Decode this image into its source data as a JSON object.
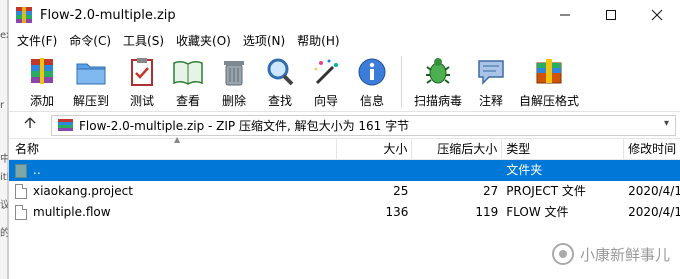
{
  "window": {
    "title": "Flow-2.0-multiple.zip"
  },
  "menu": [
    "文件(F)",
    "命令(C)",
    "工具(S)",
    "收藏夹(O)",
    "选项(N)",
    "帮助(H)"
  ],
  "toolbar": [
    {
      "label": "添加",
      "icon": "add-archive-icon"
    },
    {
      "label": "解压到",
      "icon": "extract-folder-icon"
    },
    {
      "label": "测试",
      "icon": "test-clipboard-icon"
    },
    {
      "label": "查看",
      "icon": "view-book-icon"
    },
    {
      "label": "删除",
      "icon": "trash-icon"
    },
    {
      "label": "查找",
      "icon": "magnifier-icon"
    },
    {
      "label": "向导",
      "icon": "wizard-wand-icon"
    },
    {
      "label": "信息",
      "icon": "info-icon"
    },
    {
      "label": "扫描病毒",
      "icon": "virus-scan-icon"
    },
    {
      "label": "注释",
      "icon": "comment-icon"
    },
    {
      "label": "自解压格式",
      "icon": "sfx-icon"
    }
  ],
  "address": {
    "text": "Flow-2.0-multiple.zip - ZIP 压缩文件, 解包大小为 161 字节"
  },
  "columns": {
    "name": "名称",
    "size": "大小",
    "packed": "压缩后大小",
    "type": "类型",
    "modified": "修改时间"
  },
  "rows": [
    {
      "name": "..",
      "size": "",
      "packed": "",
      "type": "文件夹",
      "modified": ""
    },
    {
      "name": "xiaokang.project",
      "size": "25",
      "packed": "27",
      "type": "PROJECT 文件",
      "modified": "2020/4/1"
    },
    {
      "name": "multiple.flow",
      "size": "136",
      "packed": "119",
      "type": "FLOW 文件",
      "modified": "2020/4/1"
    }
  ],
  "watermark": "小康新鲜事儿",
  "behind_window_chars": [
    "ex",
    "r",
    "中",
    "ith",
    "议",
    "的"
  ]
}
